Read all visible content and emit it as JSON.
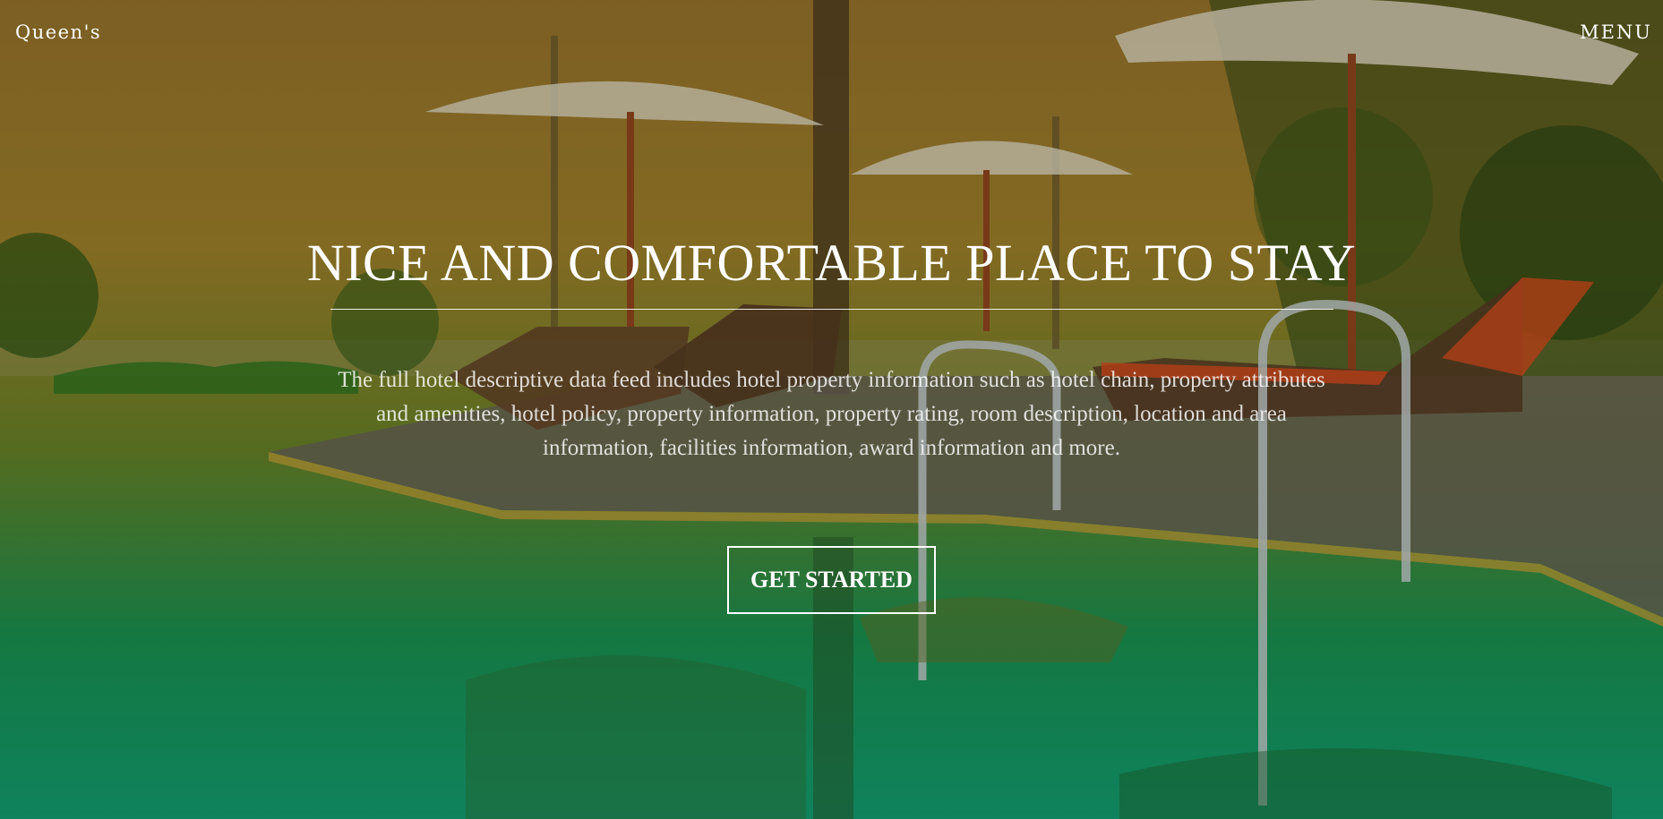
{
  "header": {
    "brand": "Queen's",
    "menu_label": "MENU"
  },
  "hero": {
    "headline": "NICE AND COMFORTABLE PLACE TO STAY",
    "description": "The full hotel descriptive data feed includes hotel property information such as hotel chain, property attributes and amenities, hotel policy, property information, property rating, room description, location and area information, facilities information, award information and more.",
    "cta_label": "GET STARTED"
  },
  "colors": {
    "text": "#ffffff",
    "sky_top": "#a07a2e",
    "pool_bottom": "#14a878"
  }
}
